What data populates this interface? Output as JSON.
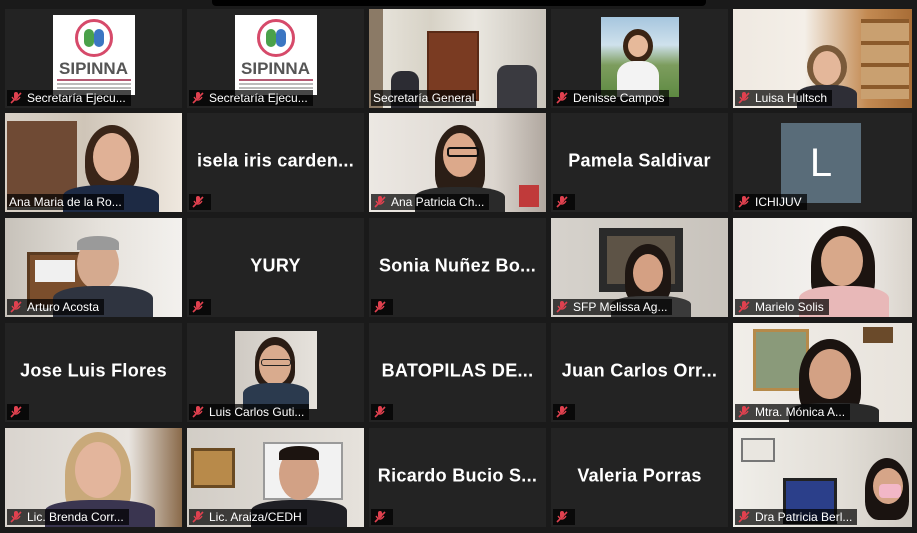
{
  "meeting": {
    "tiles": [
      {
        "label": "Secretaría Ejecu...",
        "kind": "logo",
        "logo_text": "SIPINNA",
        "muted": true
      },
      {
        "label": "Secretaría Ejecu...",
        "kind": "logo",
        "logo_text": "SIPINNA",
        "muted": true
      },
      {
        "label": "Secretaría General",
        "kind": "video",
        "muted": false
      },
      {
        "label": "Denisse Campos",
        "kind": "video",
        "muted": true
      },
      {
        "label": "Luisa Hultsch",
        "kind": "video",
        "muted": true
      },
      {
        "label": "Ana Maria de la Ro...",
        "kind": "video",
        "muted": false,
        "active": true
      },
      {
        "big_name": "isela iris carden...",
        "label": "",
        "kind": "name",
        "muted": true
      },
      {
        "label": "Ana Patricia Ch...",
        "kind": "video",
        "muted": true
      },
      {
        "big_name": "Pamela Saldivar",
        "label": "",
        "kind": "name",
        "muted": true
      },
      {
        "label": "ICHIJUV",
        "kind": "avatar",
        "avatar_letter": "L",
        "muted": true
      },
      {
        "label": "Arturo Acosta",
        "kind": "video",
        "muted": true
      },
      {
        "big_name": "YURY",
        "label": "",
        "kind": "name",
        "muted": true
      },
      {
        "big_name": "Sonia Nuñez Bo...",
        "label": "",
        "kind": "name",
        "muted": true
      },
      {
        "label": "SFP Melissa Ag...",
        "kind": "video",
        "muted": true
      },
      {
        "label": "Marielo Solis",
        "kind": "video",
        "muted": true
      },
      {
        "big_name": "Jose Luis Flores",
        "label": "",
        "kind": "name",
        "muted": true
      },
      {
        "label": "Luis Carlos Guti...",
        "kind": "video",
        "muted": true
      },
      {
        "big_name": "BATOPILAS DE...",
        "label": "",
        "kind": "name",
        "muted": true
      },
      {
        "big_name": "Juan Carlos Orr...",
        "label": "",
        "kind": "name",
        "muted": true
      },
      {
        "label": "Mtra. Mónica A...",
        "kind": "video",
        "muted": true
      },
      {
        "label": "Lic. Brenda Corr...",
        "kind": "video",
        "muted": true
      },
      {
        "label": "Lic. Araiza/CEDH",
        "kind": "video",
        "muted": true
      },
      {
        "big_name": "Ricardo Bucio S...",
        "label": "",
        "kind": "name",
        "muted": true
      },
      {
        "big_name": "Valeria Porras",
        "label": "",
        "kind": "name",
        "muted": true
      },
      {
        "label": "Dra Patricia Berl...",
        "kind": "video",
        "muted": true
      }
    ],
    "colors": {
      "active_speaker": "#d9e36b",
      "muted_icon": "#e0414f",
      "tile_bg": "#232323"
    },
    "icons": {
      "muted": "microphone-muted-icon"
    }
  }
}
